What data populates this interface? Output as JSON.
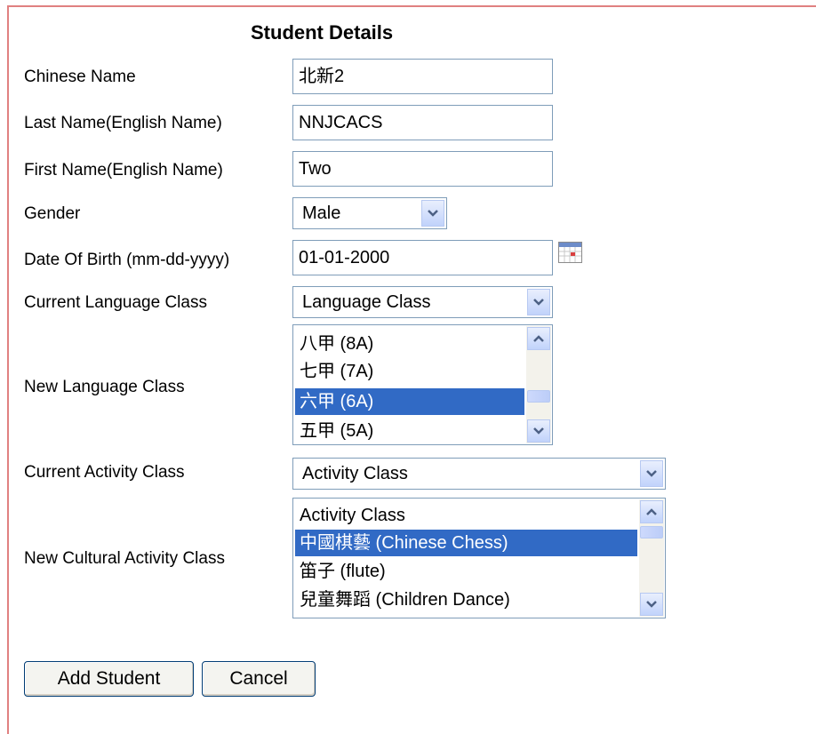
{
  "form": {
    "title": "Student Details",
    "fields": {
      "chinese_name": {
        "label": "Chinese Name",
        "value": "北新2"
      },
      "last_name": {
        "label": "Last Name(English Name)",
        "value": "NNJCACS"
      },
      "first_name": {
        "label": "First Name(English Name)",
        "value": "Two"
      },
      "gender": {
        "label": "Gender",
        "selected": "Male"
      },
      "dob": {
        "label": "Date Of Birth (mm-dd-yyyy)",
        "value": "01-01-2000"
      },
      "current_language_class": {
        "label": "Current Language Class",
        "selected": "Language Class"
      },
      "new_language_class": {
        "label": "New Language Class",
        "options": [
          "八甲 (8A)",
          "七甲 (7A)",
          "六甲 (6A)",
          "五甲 (5A)"
        ],
        "selected": "六甲 (6A)"
      },
      "current_activity_class": {
        "label": "Current Activity Class",
        "selected": "Activity Class"
      },
      "new_cultural_activity_class": {
        "label": "New Cultural Activity Class",
        "options": [
          "Activity Class",
          "中國棋藝 (Chinese Chess)",
          "笛子 (flute)",
          "兒童舞蹈 (Children Dance)"
        ],
        "selected": "中國棋藝 (Chinese Chess)"
      }
    },
    "buttons": {
      "add_student": "Add Student",
      "cancel": "Cancel"
    }
  },
  "icons": {
    "calendar": "calendar-icon",
    "dropdown": "chevron-down-icon",
    "scroll_up": "arrow-up-icon",
    "scroll_down": "arrow-down-icon"
  },
  "colors": {
    "frame_border": "#e08080",
    "selection": "#316ac5",
    "input_border": "#7f9db9"
  }
}
